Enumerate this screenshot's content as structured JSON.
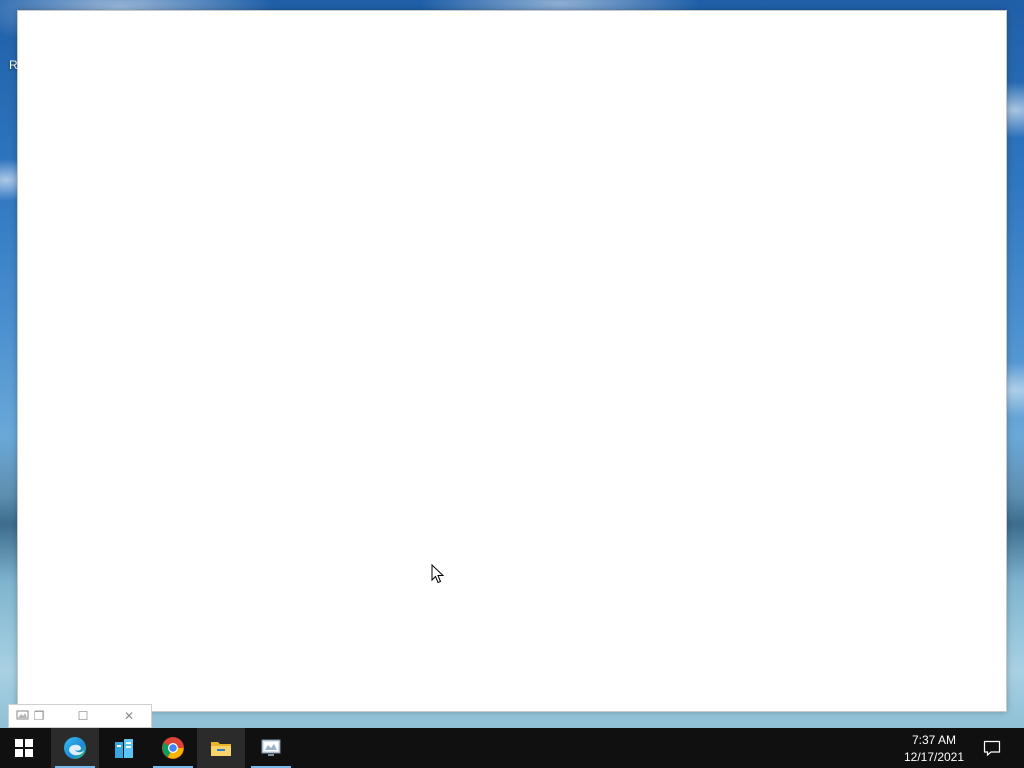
{
  "desktop": {
    "label": "R"
  },
  "mini_window": {
    "icon": "window-icon",
    "restore_glyph": "❐",
    "maximize_glyph": "☐",
    "close_glyph": "✕"
  },
  "taskbar": {
    "apps": [
      {
        "name": "start",
        "icon": "windows-logo-icon"
      },
      {
        "name": "edge",
        "icon": "edge-icon",
        "active": true,
        "running": true
      },
      {
        "name": "server-manager",
        "icon": "server-manager-icon"
      },
      {
        "name": "chrome",
        "icon": "chrome-icon",
        "running": true
      },
      {
        "name": "file-explorer",
        "icon": "folder-icon",
        "active": true
      },
      {
        "name": "remote-desktop",
        "icon": "remote-desktop-icon",
        "running": true
      }
    ],
    "clock": {
      "time": "7:37 AM",
      "date": "12/17/2021"
    },
    "action_center_icon": "notification-icon"
  },
  "colors": {
    "taskbar_bg": "#101010",
    "running_indicator": "#76b9ed",
    "window_bg": "#ffffff"
  }
}
